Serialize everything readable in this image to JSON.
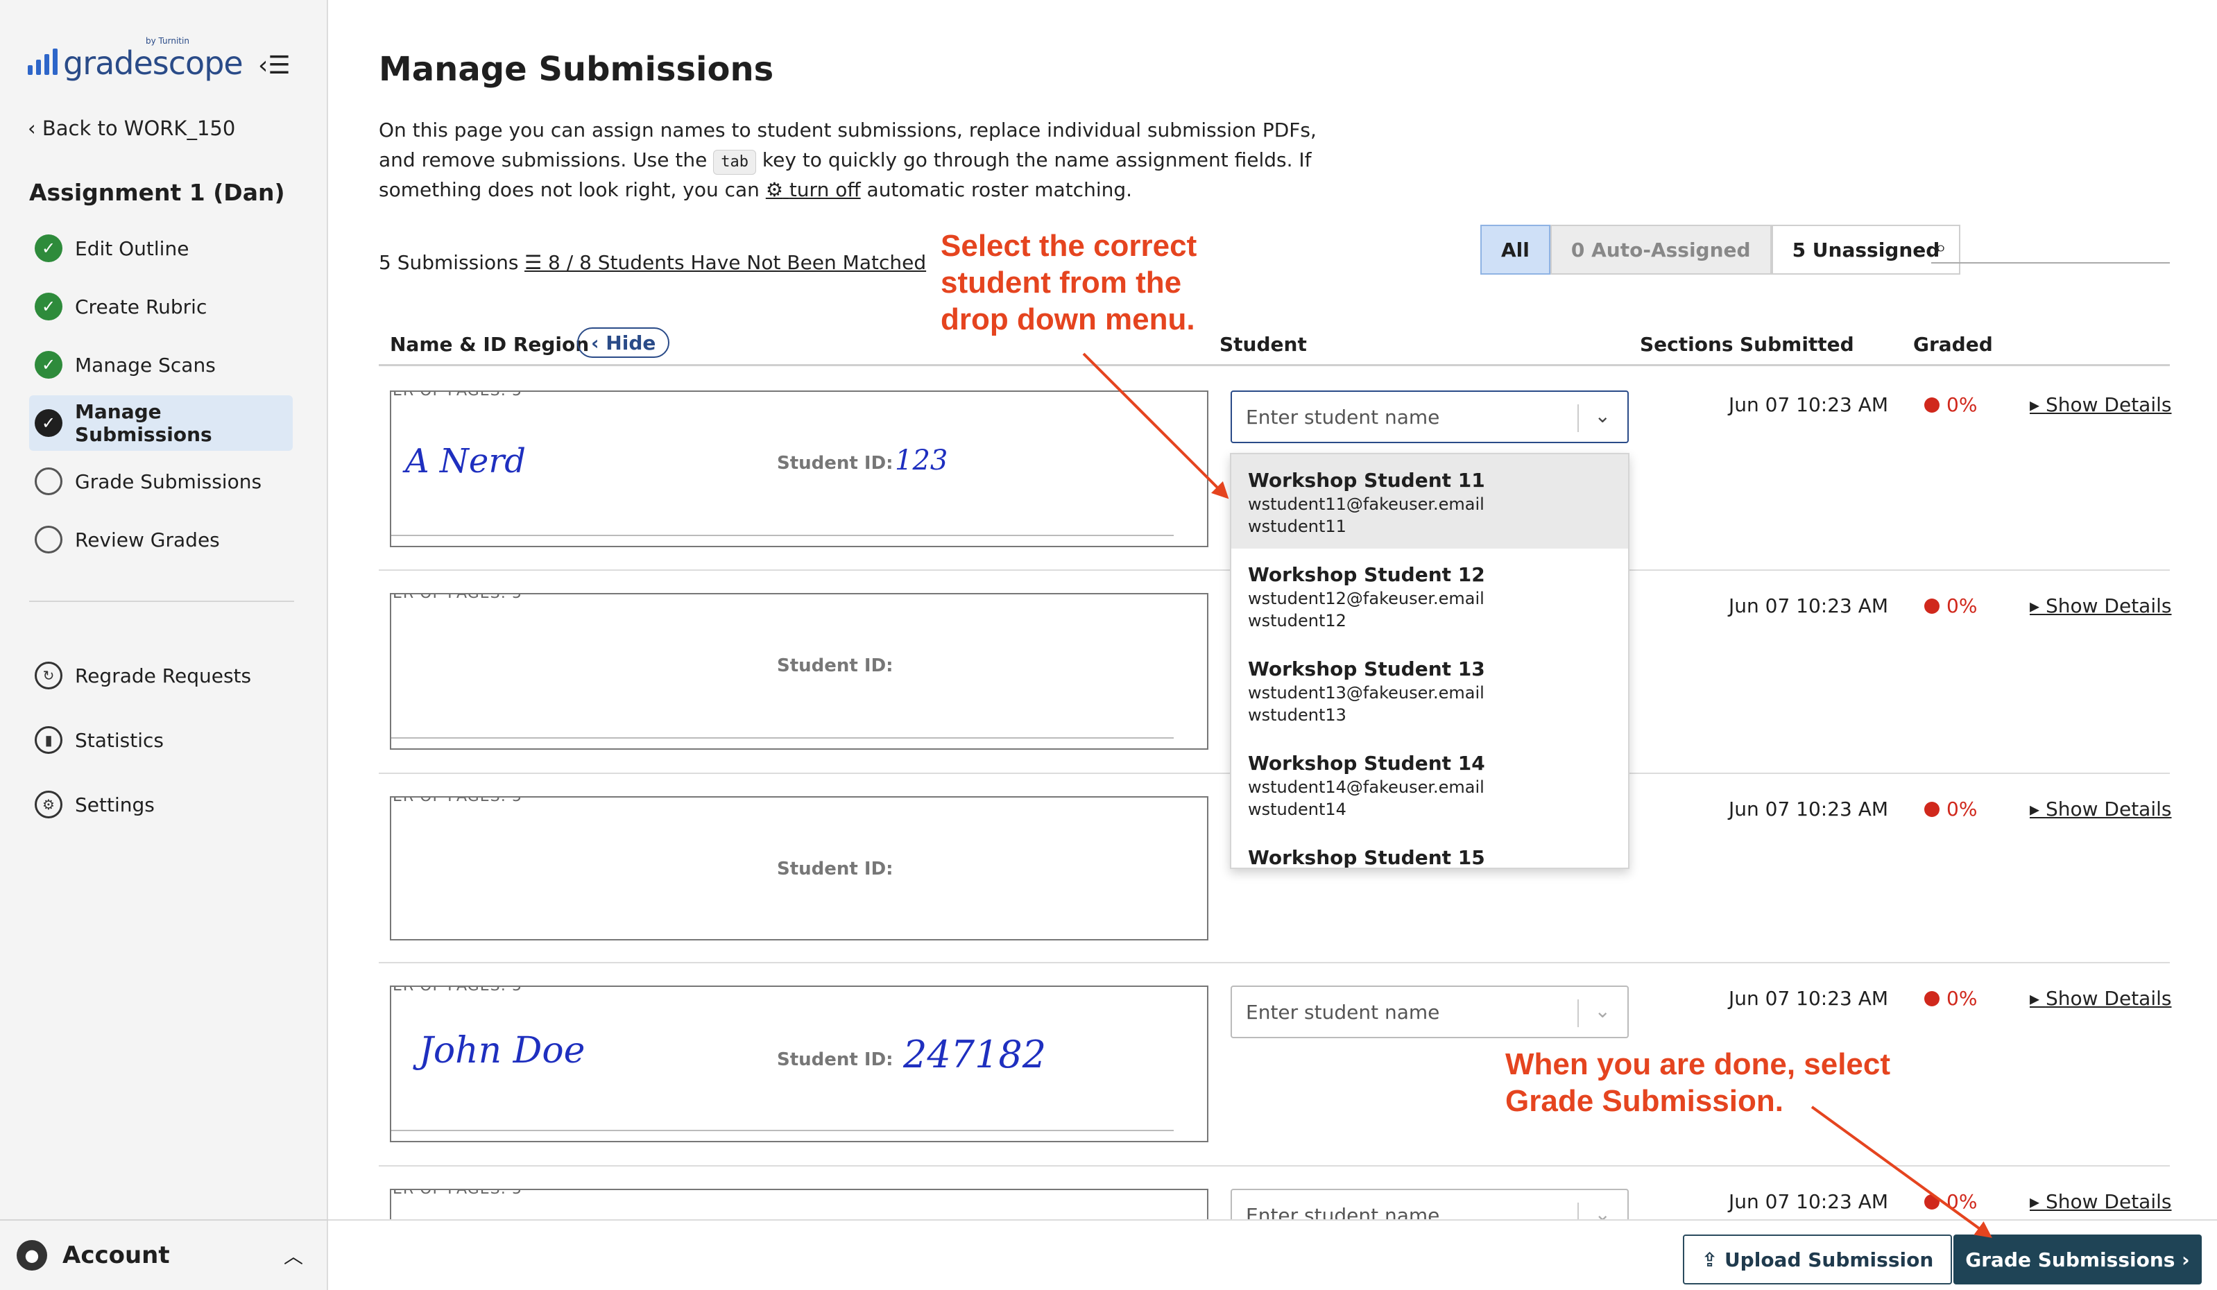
{
  "sidebar": {
    "logo_text": "gradescope",
    "logo_sub": "by Turnitin",
    "back_link": "Back to WORK_150",
    "assignment_title": "Assignment 1 (Dan)",
    "items": [
      {
        "label": "Edit Outline",
        "icon": "check-circle-icon"
      },
      {
        "label": "Create Rubric",
        "icon": "check-circle-icon"
      },
      {
        "label": "Manage Scans",
        "icon": "check-circle-icon"
      },
      {
        "label": "Manage Submissions",
        "icon": "check-circle-icon"
      },
      {
        "label": "Grade Submissions",
        "icon": "empty-circle-icon"
      },
      {
        "label": "Review Grades",
        "icon": "empty-circle-icon"
      }
    ],
    "tools": [
      {
        "label": "Regrade Requests",
        "icon": "regrade-icon"
      },
      {
        "label": "Statistics",
        "icon": "bar-chart-icon"
      },
      {
        "label": "Settings",
        "icon": "gear-icon"
      }
    ],
    "account_label": "Account"
  },
  "main": {
    "title": "Manage Submissions",
    "intro_1": "On this page you can assign names to student submissions, replace individual submission PDFs, and remove submissions. Use the ",
    "intro_kbd": "tab",
    "intro_2": " key to quickly go through the name assignment fields. If something does not look right, you can ",
    "intro_link": "turn off",
    "intro_3": " automatic roster matching.",
    "submission_count": "5 Submissions",
    "not_matched": "8 / 8 Students Have Not Been Matched",
    "filters": {
      "all": "All",
      "auto": "0 Auto-Assigned",
      "unassigned": "5 Unassigned"
    },
    "annotation_1": [
      "Select the correct",
      "student from the",
      "drop down menu."
    ],
    "annotation_2": [
      "When you are done, select",
      "Grade Submission."
    ],
    "columns": {
      "name_id": "Name & ID Region",
      "hide": "Hide",
      "student": "Student",
      "sections": "Sections",
      "submitted": "Submitted",
      "graded": "Graded"
    },
    "scan_header": "ER OF PAGES:  5",
    "student_id_label": "Student ID:",
    "select_placeholder": "Enter student name",
    "rows": [
      {
        "name_hw": "A  Nerd",
        "id_hw": "123",
        "submitted": "Jun 07 10:23 AM",
        "graded": "0%",
        "details": "Show Details"
      },
      {
        "name_hw": "",
        "id_hw": "",
        "submitted": "Jun 07 10:23 AM",
        "graded": "0%",
        "details": "Show Details"
      },
      {
        "name_hw": "",
        "id_hw": "",
        "submitted": "Jun 07 10:23 AM",
        "graded": "0%",
        "details": "Show Details"
      },
      {
        "name_hw": "John  Doe",
        "id_hw": "247182",
        "submitted": "Jun 07 10:23 AM",
        "graded": "0%",
        "details": "Show Details"
      },
      {
        "name_hw": "",
        "id_hw": "",
        "submitted": "Jun 07 10:23 AM",
        "graded": "0%",
        "details": "Show Details"
      }
    ],
    "dropdown_options": [
      {
        "name": "Workshop Student 11",
        "email": "wstudent11@fakeuser.email",
        "sid": "wstudent11"
      },
      {
        "name": "Workshop Student 12",
        "email": "wstudent12@fakeuser.email",
        "sid": "wstudent12"
      },
      {
        "name": "Workshop Student 13",
        "email": "wstudent13@fakeuser.email",
        "sid": "wstudent13"
      },
      {
        "name": "Workshop Student 14",
        "email": "wstudent14@fakeuser.email",
        "sid": "wstudent14"
      },
      {
        "name": "Workshop Student 15",
        "email": "",
        "sid": ""
      }
    ]
  },
  "footer": {
    "upload": "Upload Submission",
    "grade": "Grade Submissions"
  },
  "colors": {
    "accent": "#2a4b88",
    "annotation": "#e5441f",
    "graded_red": "#d0281c",
    "primary_button": "#1f4456"
  }
}
